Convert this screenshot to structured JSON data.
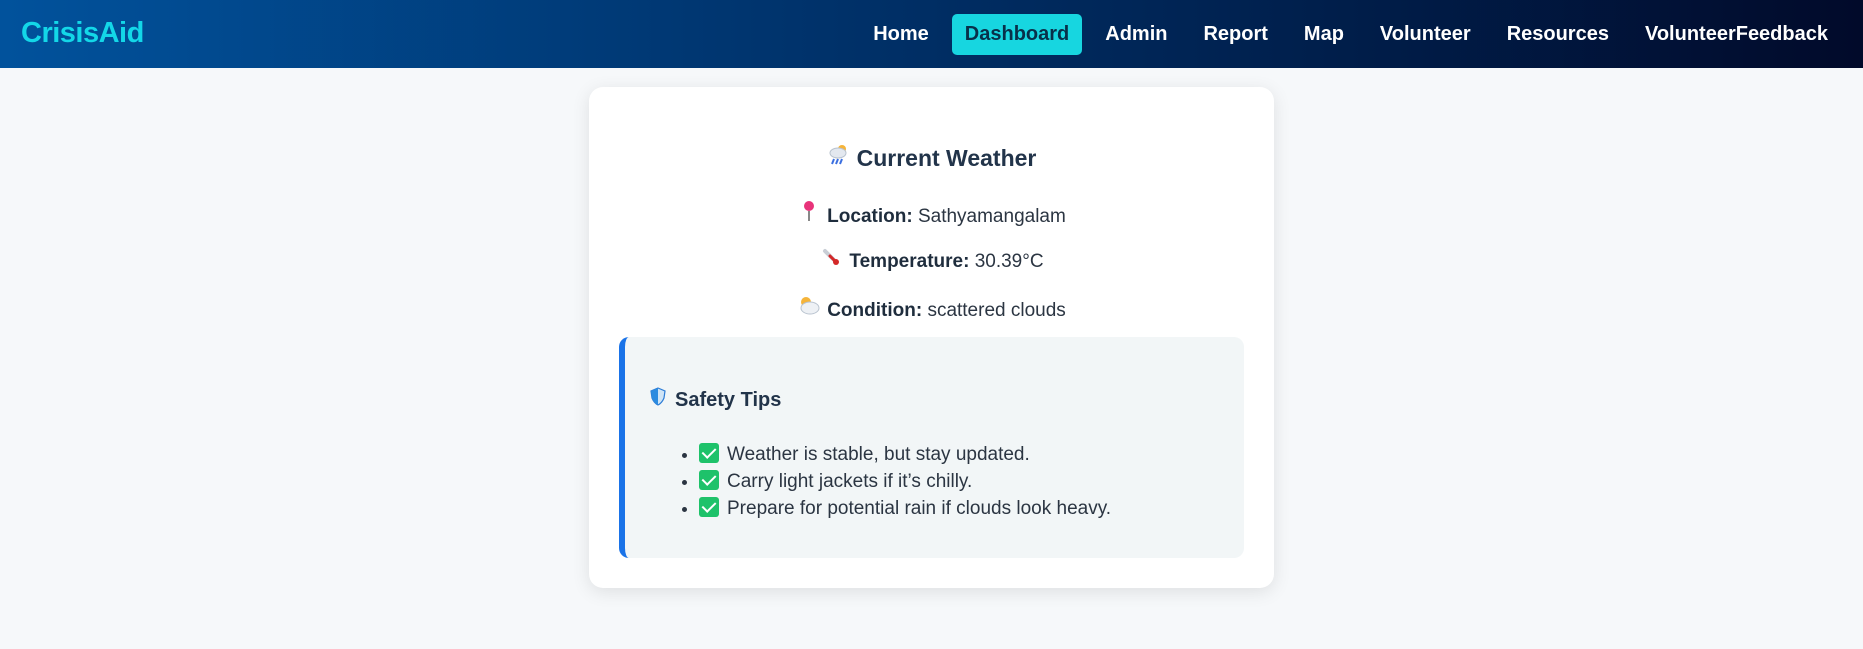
{
  "brand": "CrisisAid",
  "nav": {
    "items": [
      "Home",
      "Dashboard",
      "Admin",
      "Report",
      "Map",
      "Volunteer",
      "Resources",
      "VolunteerFeedback"
    ],
    "active": "Dashboard"
  },
  "weather": {
    "title": "Current Weather",
    "title_icon": "rain-cloud-icon",
    "location_label": "Location:",
    "location_value": "Sathyamangalam",
    "temperature_label": "Temperature:",
    "temperature_value": "30.39°C",
    "condition_label": "Condition:",
    "condition_value": "scattered clouds"
  },
  "safety": {
    "title": "Safety Tips",
    "title_icon": "shield-icon",
    "tips": [
      "Weather is stable, but stay updated.",
      "Carry light jackets if it’s chilly.",
      "Prepare for potential rain if clouds look heavy."
    ]
  },
  "colors": {
    "brand": "#13d7e8",
    "active_nav_bg": "#17d6e0",
    "tips_border": "#1a73e8",
    "check": "#1ec26a"
  }
}
